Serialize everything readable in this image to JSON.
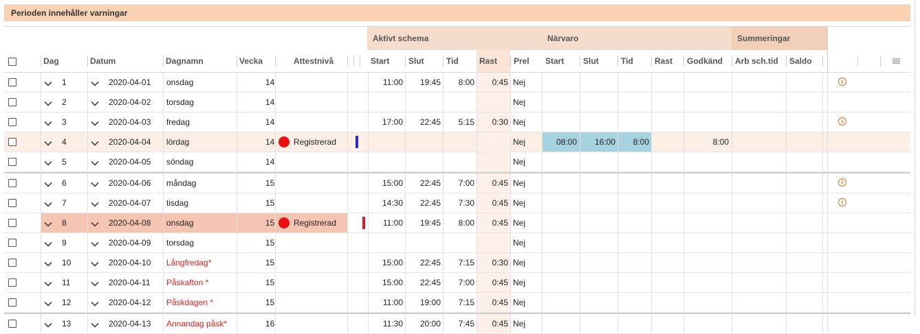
{
  "warning": "Perioden innehåller varningar",
  "groups": {
    "aktivt": "Aktivt schema",
    "narvaro": "Närvaro",
    "summeringar": "Summeringar"
  },
  "headers": {
    "dag": "Dag",
    "datum": "Datum",
    "dagnamn": "Dagnamn",
    "vecka": "Vecka",
    "attestniva": "Attestnivå",
    "start": "Start",
    "slut": "Slut",
    "tid": "Tid",
    "rast": "Rast",
    "prel": "Prel",
    "n_start": "Start",
    "n_slut": "Slut",
    "n_tid": "Tid",
    "n_rast": "Rast",
    "godkand": "Godkänd",
    "arbschtid": "Arb sch.tid",
    "saldo": "Saldo"
  },
  "colors": {
    "warning_bg": "#f9d2b3",
    "highlight_row": "#fdeee6",
    "error_row": "#f5c4b3",
    "narvaro_cells": "#a7d3e0",
    "rast_col": "#fdf0e8",
    "info": "#e07020"
  },
  "rows": [
    {
      "dag": "1",
      "datum": "2020-04-01",
      "dagnamn": "onsdag",
      "vecka": "14",
      "attest": "",
      "start": "11:00",
      "slut": "19:45",
      "tid": "8:00",
      "rast": "0:45",
      "prel": "Nej",
      "n_start": "",
      "n_slut": "",
      "n_tid": "",
      "godkand": "",
      "info": true
    },
    {
      "dag": "2",
      "datum": "2020-04-02",
      "dagnamn": "torsdag",
      "vecka": "14",
      "attest": "",
      "start": "",
      "slut": "",
      "tid": "",
      "rast": "",
      "prel": "Nej",
      "n_start": "",
      "n_slut": "",
      "n_tid": "",
      "godkand": "",
      "info": false
    },
    {
      "dag": "3",
      "datum": "2020-04-03",
      "dagnamn": "fredag",
      "vecka": "14",
      "attest": "",
      "start": "17:00",
      "slut": "22:45",
      "tid": "5:15",
      "rast": "0:30",
      "prel": "Nej",
      "n_start": "",
      "n_slut": "",
      "n_tid": "",
      "godkand": "",
      "info": true
    },
    {
      "dag": "4",
      "datum": "2020-04-04",
      "dagnamn": "lördag",
      "vecka": "14",
      "attest": "Registrerad",
      "start": "",
      "slut": "",
      "tid": "",
      "rast": "",
      "prel": "Nej",
      "n_start": "08:00",
      "n_slut": "16:00",
      "n_tid": "8:00",
      "godkand": "8:00",
      "info": false,
      "highlight": true,
      "marker": "blue"
    },
    {
      "dag": "5",
      "datum": "2020-04-05",
      "dagnamn": "söndag",
      "vecka": "14",
      "attest": "",
      "start": "",
      "slut": "",
      "tid": "",
      "rast": "",
      "prel": "Nej",
      "n_start": "",
      "n_slut": "",
      "n_tid": "",
      "godkand": "",
      "info": false
    },
    {
      "dag": "6",
      "datum": "2020-04-06",
      "dagnamn": "måndag",
      "vecka": "15",
      "attest": "",
      "start": "15:00",
      "slut": "22:45",
      "tid": "7:00",
      "rast": "0:45",
      "prel": "Nej",
      "n_start": "",
      "n_slut": "",
      "n_tid": "",
      "godkand": "",
      "info": true,
      "sep": true
    },
    {
      "dag": "7",
      "datum": "2020-04-07",
      "dagnamn": "tisdag",
      "vecka": "15",
      "attest": "",
      "start": "14:30",
      "slut": "22:45",
      "tid": "7:30",
      "rast": "0:45",
      "prel": "Nej",
      "n_start": "",
      "n_slut": "",
      "n_tid": "",
      "godkand": "",
      "info": true
    },
    {
      "dag": "8",
      "datum": "2020-04-08",
      "dagnamn": "onsdag",
      "vecka": "15",
      "attest": "Registrerad",
      "start": "11:00",
      "slut": "19:45",
      "tid": "8:00",
      "rast": "0:45",
      "prel": "Nej",
      "n_start": "",
      "n_slut": "",
      "n_tid": "",
      "godkand": "",
      "info": false,
      "error": true,
      "marker": "red"
    },
    {
      "dag": "9",
      "datum": "2020-04-09",
      "dagnamn": "torsdag",
      "vecka": "15",
      "attest": "",
      "start": "",
      "slut": "",
      "tid": "",
      "rast": "",
      "prel": "Nej",
      "n_start": "",
      "n_slut": "",
      "n_tid": "",
      "godkand": "",
      "info": false
    },
    {
      "dag": "10",
      "datum": "2020-04-10",
      "dagnamn": "Långfredag*",
      "vecka": "15",
      "attest": "",
      "start": "15:00",
      "slut": "22:45",
      "tid": "7:15",
      "rast": "0:30",
      "prel": "Nej",
      "n_start": "",
      "n_slut": "",
      "n_tid": "",
      "godkand": "",
      "info": false,
      "holiday": true
    },
    {
      "dag": "11",
      "datum": "2020-04-11",
      "dagnamn": "Påskafton *",
      "vecka": "15",
      "attest": "",
      "start": "15:00",
      "slut": "22:45",
      "tid": "7:00",
      "rast": "0:45",
      "prel": "Nej",
      "n_start": "",
      "n_slut": "",
      "n_tid": "",
      "godkand": "",
      "info": false,
      "holiday": true
    },
    {
      "dag": "12",
      "datum": "2020-04-12",
      "dagnamn": "Påskdagen *",
      "vecka": "15",
      "attest": "",
      "start": "11:00",
      "slut": "19:00",
      "tid": "7:15",
      "rast": "0:45",
      "prel": "Nej",
      "n_start": "",
      "n_slut": "",
      "n_tid": "",
      "godkand": "",
      "info": false,
      "holiday": true
    },
    {
      "dag": "13",
      "datum": "2020-04-13",
      "dagnamn": "Annandag påsk*",
      "vecka": "16",
      "attest": "",
      "start": "11:30",
      "slut": "20:00",
      "tid": "7:45",
      "rast": "0:45",
      "prel": "Nej",
      "n_start": "",
      "n_slut": "",
      "n_tid": "",
      "godkand": "",
      "info": false,
      "holiday": true,
      "sep": true
    }
  ]
}
